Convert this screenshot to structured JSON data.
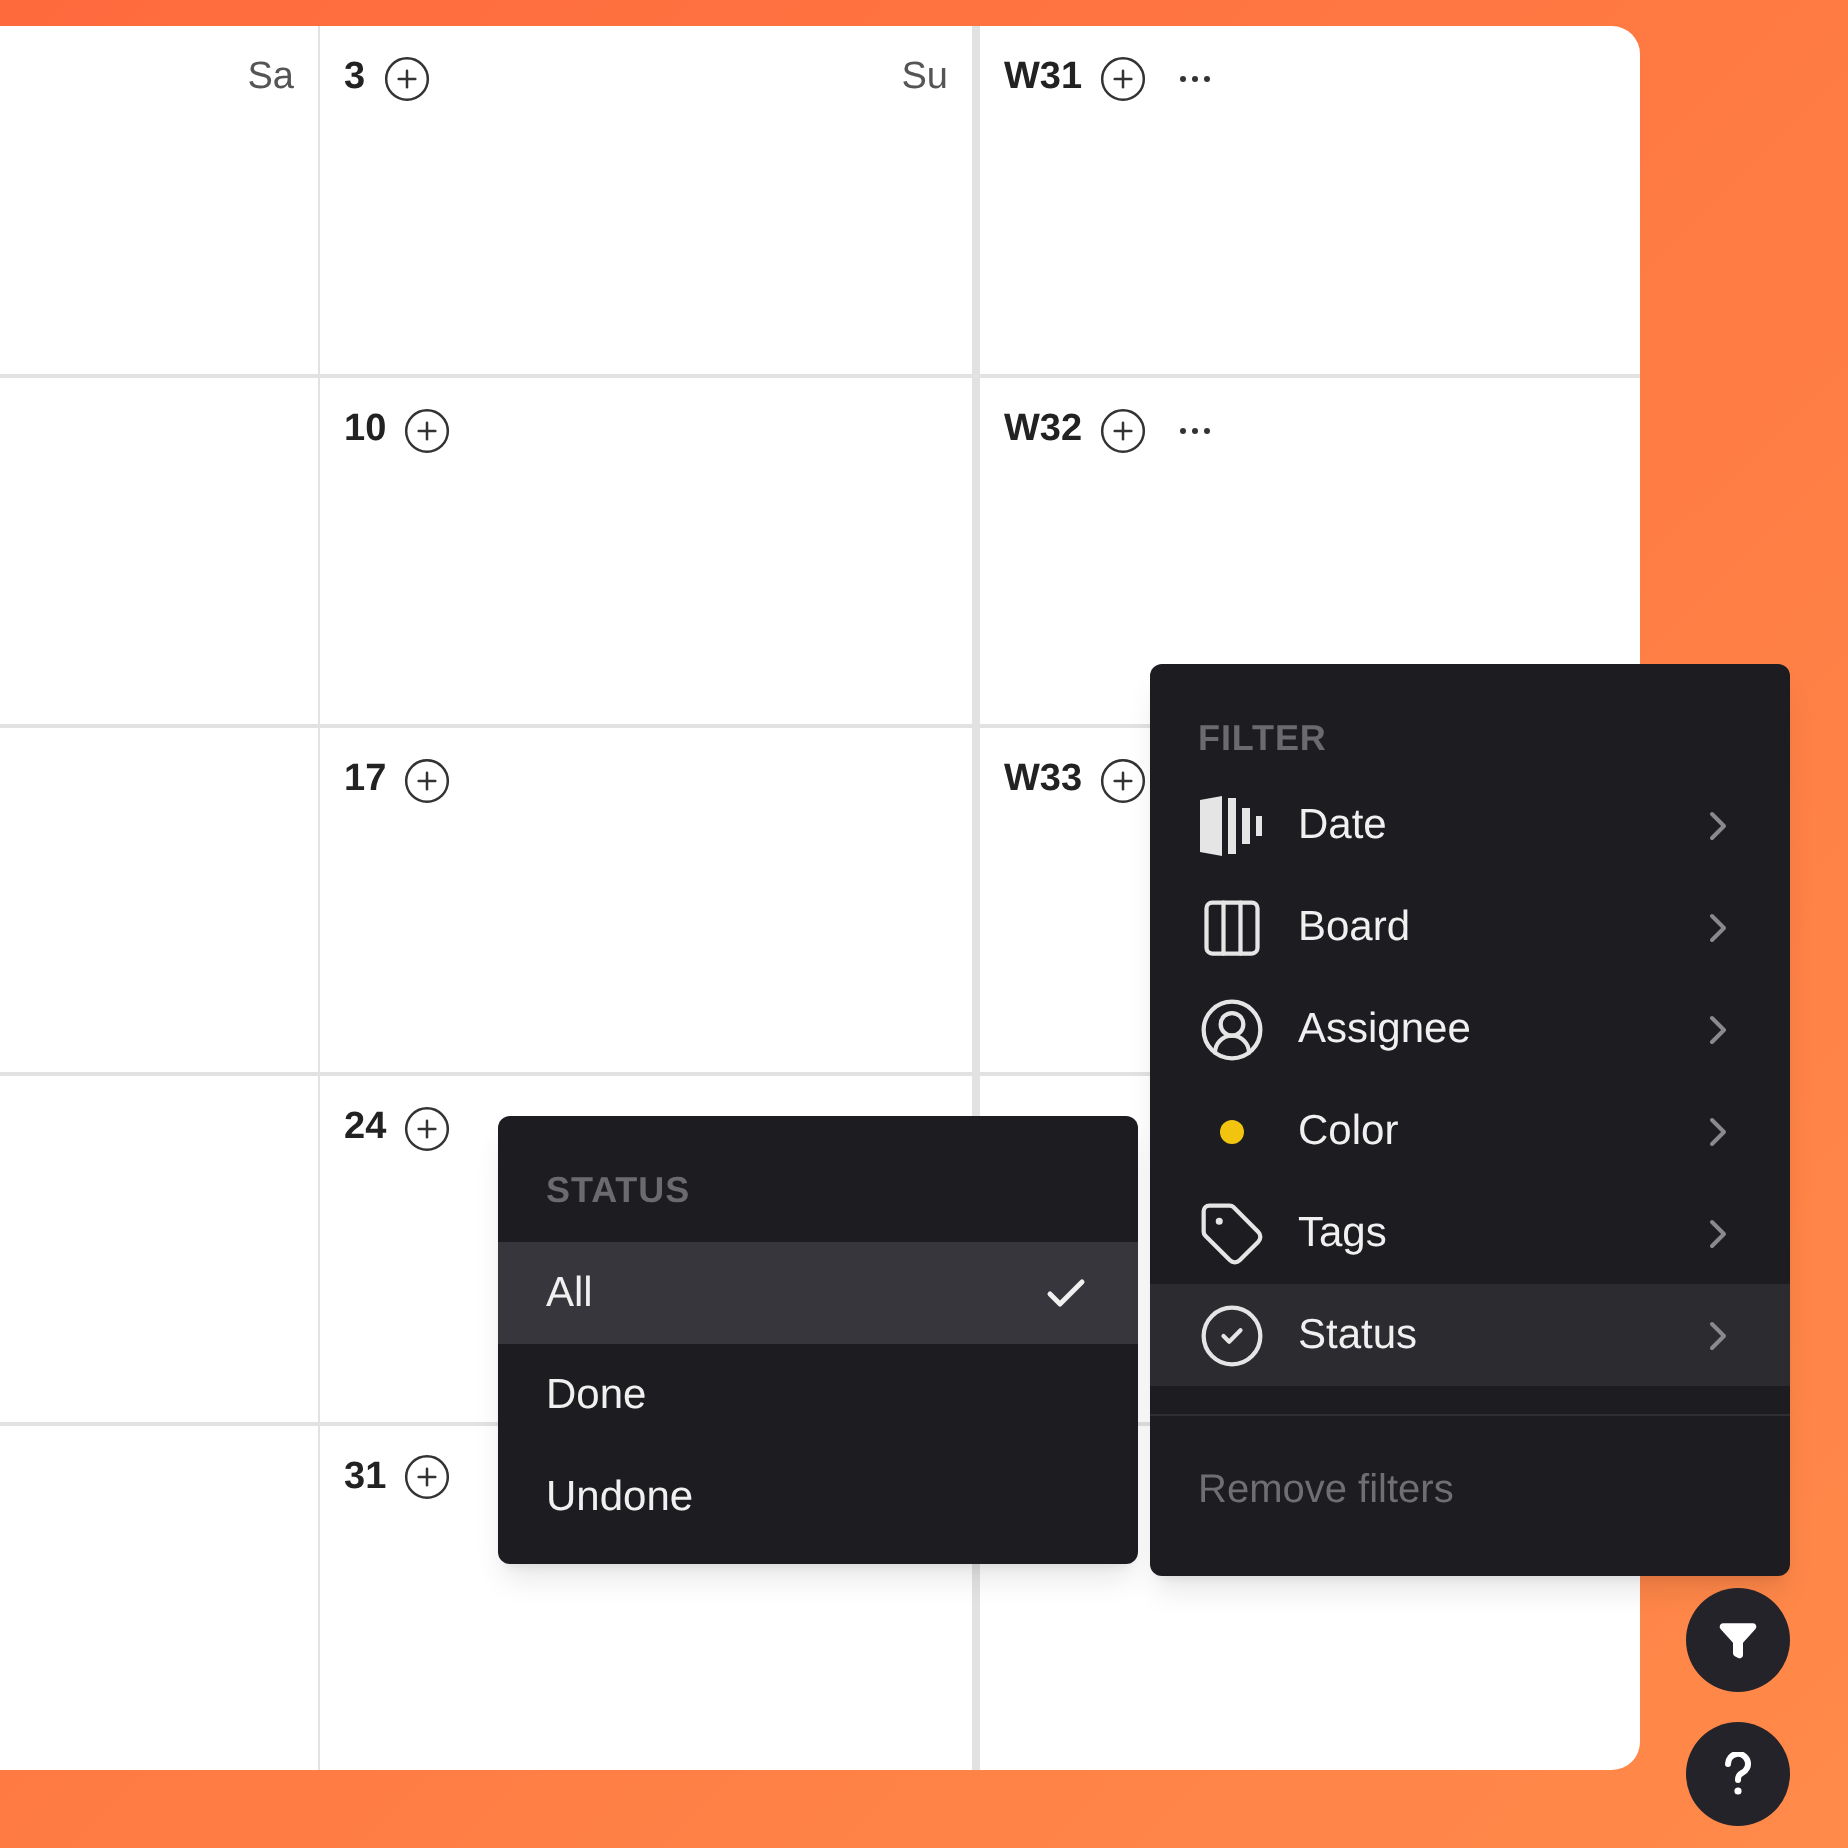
{
  "calendar": {
    "rows": [
      {
        "saturday": {
          "weekday": "Sa"
        },
        "sunday": {
          "day": "3",
          "weekday": "Su"
        },
        "week": {
          "label": "W31",
          "more": true
        }
      },
      {
        "sunday": {
          "day": "10"
        },
        "week": {
          "label": "W32",
          "more": true
        }
      },
      {
        "sunday": {
          "day": "17"
        },
        "week": {
          "label": "W33",
          "more": false
        }
      },
      {
        "sunday": {
          "day": "24"
        }
      },
      {
        "sunday": {
          "day": "31"
        }
      }
    ]
  },
  "filter_menu": {
    "title": "FILTER",
    "items": [
      {
        "kind": "date",
        "label": "Date",
        "selected": false
      },
      {
        "kind": "board",
        "label": "Board",
        "selected": false
      },
      {
        "kind": "assignee",
        "label": "Assignee",
        "selected": false
      },
      {
        "kind": "color",
        "label": "Color",
        "selected": false,
        "color": "#f2c40f"
      },
      {
        "kind": "tags",
        "label": "Tags",
        "selected": false
      },
      {
        "kind": "status",
        "label": "Status",
        "selected": true
      }
    ],
    "footer": "Remove filters"
  },
  "status_menu": {
    "title": "STATUS",
    "options": [
      {
        "label": "All",
        "selected": true
      },
      {
        "label": "Done",
        "selected": false
      },
      {
        "label": "Undone",
        "selected": false
      }
    ]
  }
}
